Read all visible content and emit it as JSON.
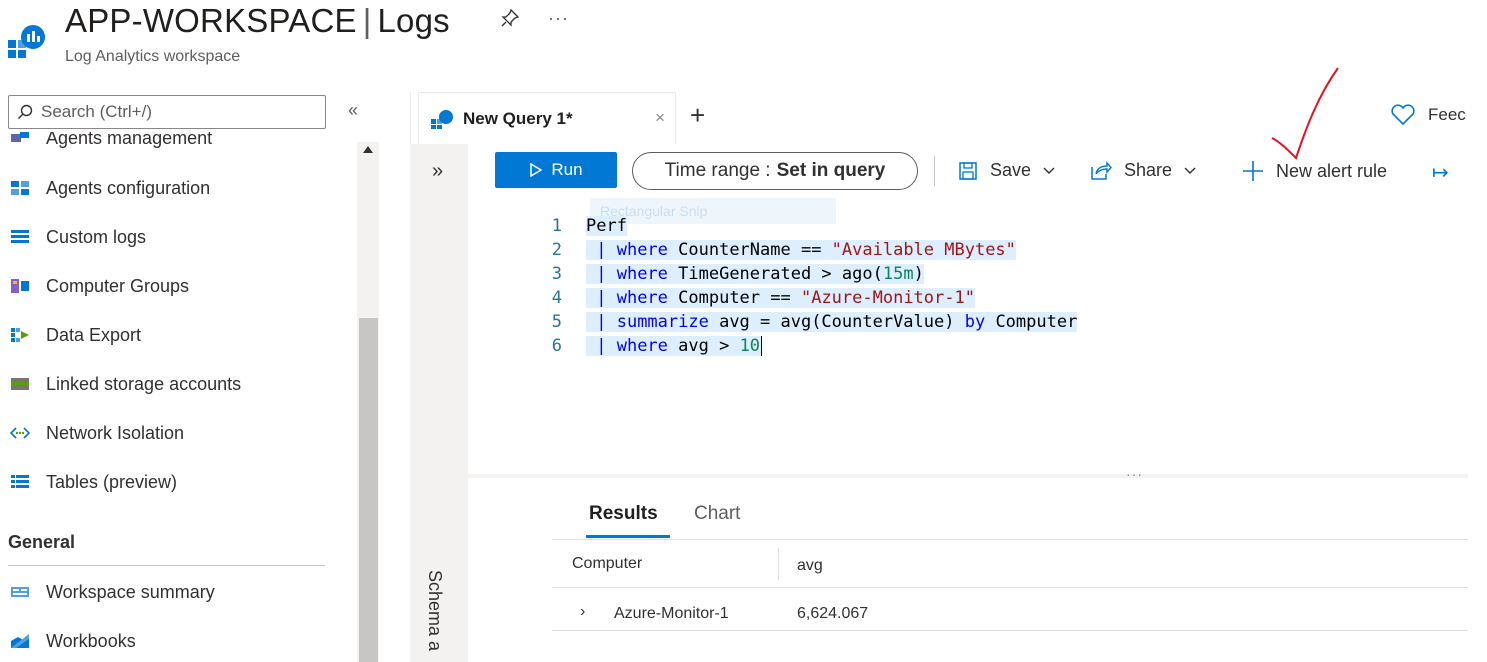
{
  "header": {
    "title_main": "APP-WORKSPACE",
    "title_separator": "|",
    "title_section": "Logs",
    "subtitle": "Log Analytics workspace",
    "more_label": "···"
  },
  "sidebar": {
    "search_placeholder": "Search (Ctrl+/)",
    "collapse_label": "«",
    "items": [
      {
        "label": "Agents management",
        "icon": "agents-icon"
      },
      {
        "label": "Agents configuration",
        "icon": "agents-config-icon"
      },
      {
        "label": "Custom logs",
        "icon": "list-icon"
      },
      {
        "label": "Computer Groups",
        "icon": "computer-groups-icon"
      },
      {
        "label": "Data Export",
        "icon": "data-export-icon"
      },
      {
        "label": "Linked storage accounts",
        "icon": "storage-icon"
      },
      {
        "label": "Network Isolation",
        "icon": "network-icon"
      },
      {
        "label": "Tables (preview)",
        "icon": "table-icon"
      }
    ],
    "section_general": "General",
    "general_items": [
      {
        "label": "Workspace summary",
        "icon": "summary-icon"
      },
      {
        "label": "Workbooks",
        "icon": "workbooks-icon"
      }
    ]
  },
  "query_tabs": {
    "active_tab": "New Query 1*",
    "close_label": "×",
    "add_label": "+"
  },
  "feedback_label": "Feec",
  "left_panel": {
    "expand_label": "»",
    "schema_label": "Schema a"
  },
  "toolbar": {
    "run_label": "Run",
    "time_range_prefix": "Time range :",
    "time_range_value": "Set in query",
    "save_label": "Save",
    "share_label": "Share",
    "new_alert_label": "New alert rule",
    "export_label": "↦"
  },
  "editor": {
    "ghost_text": "Rectangular Snip",
    "lines": [
      {
        "num": "1",
        "parts": [
          {
            "t": "Perf",
            "c": ""
          }
        ]
      },
      {
        "num": "2",
        "parts": [
          {
            "t": " | ",
            "c": "pipe"
          },
          {
            "t": "where",
            "c": "kw"
          },
          {
            "t": " CounterName == ",
            "c": ""
          },
          {
            "t": "\"Available MBytes\"",
            "c": "str"
          }
        ]
      },
      {
        "num": "3",
        "parts": [
          {
            "t": " | ",
            "c": "pipe"
          },
          {
            "t": "where",
            "c": "kw"
          },
          {
            "t": " TimeGenerated > ago(",
            "c": ""
          },
          {
            "t": "15m",
            "c": "num"
          },
          {
            "t": ")",
            "c": ""
          }
        ]
      },
      {
        "num": "4",
        "parts": [
          {
            "t": " | ",
            "c": "pipe"
          },
          {
            "t": "where",
            "c": "kw"
          },
          {
            "t": " Computer == ",
            "c": ""
          },
          {
            "t": "\"Azure-Monitor-1\"",
            "c": "str"
          }
        ]
      },
      {
        "num": "5",
        "parts": [
          {
            "t": " | ",
            "c": "pipe"
          },
          {
            "t": "summarize",
            "c": "kw"
          },
          {
            "t": " avg = avg(CounterValue) ",
            "c": ""
          },
          {
            "t": "by",
            "c": "kw"
          },
          {
            "t": " Computer",
            "c": ""
          }
        ]
      },
      {
        "num": "6",
        "parts": [
          {
            "t": " | ",
            "c": "pipe"
          },
          {
            "t": "where",
            "c": "kw"
          },
          {
            "t": " avg > ",
            "c": ""
          },
          {
            "t": "10",
            "c": "num"
          }
        ]
      }
    ],
    "splitter_label": "···"
  },
  "results": {
    "tab_results": "Results",
    "tab_chart": "Chart",
    "columns": [
      "Computer",
      "avg"
    ],
    "rows": [
      {
        "expand": "›",
        "computer": "Azure-Monitor-1",
        "avg": "6,624.067"
      }
    ]
  },
  "colors": {
    "accent": "#0078d4",
    "annotation": "#e81123"
  }
}
